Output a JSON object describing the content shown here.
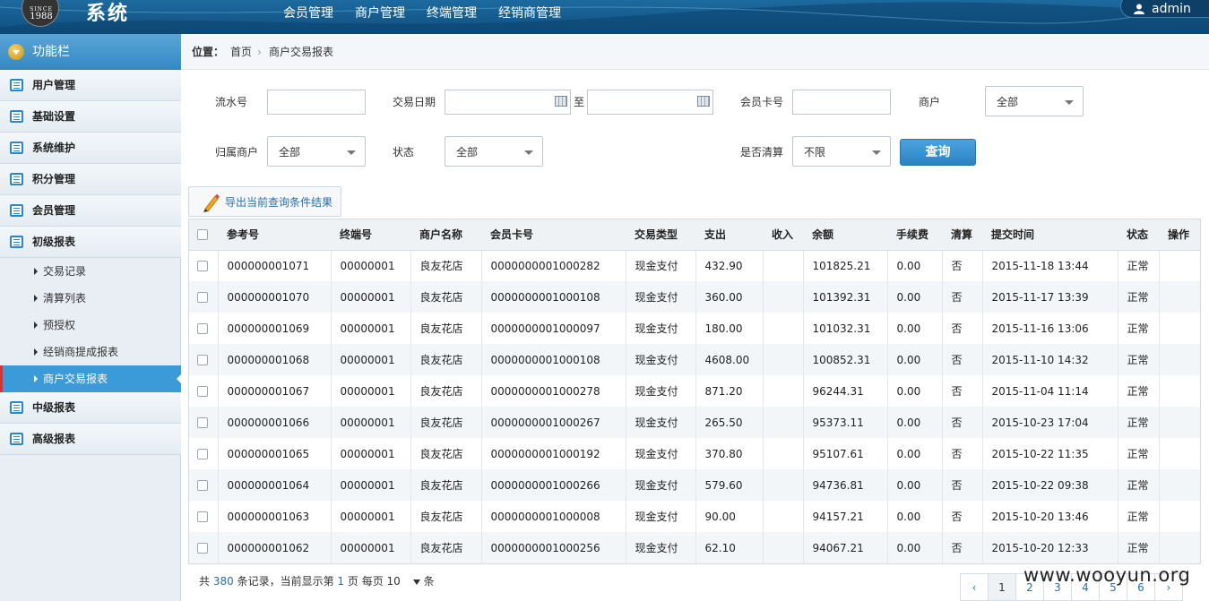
{
  "header": {
    "logo": {
      "since": "SINCE",
      "year": "1988"
    },
    "title": "系统",
    "nav": [
      "会员管理",
      "商户管理",
      "终端管理",
      "经销商管理"
    ],
    "user": "admin"
  },
  "sidebar": {
    "title": "功能栏",
    "items_top": [
      "用户管理",
      "基础设置",
      "系统维护",
      "积分管理",
      "会员管理",
      "初级报表"
    ],
    "sub_items": [
      "交易记录",
      "清算列表",
      "预授权",
      "经销商提成报表",
      "商户交易报表"
    ],
    "active_sub": "商户交易报表",
    "items_bottom": [
      "中级报表",
      "高级报表"
    ]
  },
  "breadcrumb": {
    "label": "位置：",
    "home": "首页",
    "sep": "›",
    "current": "商户交易报表"
  },
  "form": {
    "serial_label": "流水号",
    "serial_value": "",
    "date_label": "交易日期",
    "date_to": "至",
    "card_label": "会员卡号",
    "merchant_label": "商户",
    "merchant_value": "全部",
    "owner_label": "归属商户",
    "owner_value": "全部",
    "status_label": "状态",
    "status_value": "全部",
    "cleared_label": "是否清算",
    "cleared_value": "不限",
    "search_button": "查询",
    "export_button": "导出当前查询条件结果"
  },
  "table": {
    "columns": [
      "参考号",
      "终端号",
      "商户名称",
      "会员卡号",
      "交易类型",
      "支出",
      "收入",
      "余额",
      "手续费",
      "清算",
      "提交时间",
      "状态",
      "操作"
    ],
    "rows": [
      [
        "000000001071",
        "00000001",
        "良友花店",
        "0000000001000282",
        "现金支付",
        "432.90",
        "",
        "101825.21",
        "0.00",
        "否",
        "2015-11-18 13:44",
        "正常",
        ""
      ],
      [
        "000000001070",
        "00000001",
        "良友花店",
        "0000000001000108",
        "现金支付",
        "360.00",
        "",
        "101392.31",
        "0.00",
        "否",
        "2015-11-17 13:39",
        "正常",
        ""
      ],
      [
        "000000001069",
        "00000001",
        "良友花店",
        "0000000001000097",
        "现金支付",
        "180.00",
        "",
        "101032.31",
        "0.00",
        "否",
        "2015-11-16 13:06",
        "正常",
        ""
      ],
      [
        "000000001068",
        "00000001",
        "良友花店",
        "0000000001000108",
        "现金支付",
        "4608.00",
        "",
        "100852.31",
        "0.00",
        "否",
        "2015-11-10 14:32",
        "正常",
        ""
      ],
      [
        "000000001067",
        "00000001",
        "良友花店",
        "0000000001000278",
        "现金支付",
        "871.20",
        "",
        "96244.31",
        "0.00",
        "否",
        "2015-11-04 11:14",
        "正常",
        ""
      ],
      [
        "000000001066",
        "00000001",
        "良友花店",
        "0000000001000267",
        "现金支付",
        "265.50",
        "",
        "95373.11",
        "0.00",
        "否",
        "2015-10-23 17:04",
        "正常",
        ""
      ],
      [
        "000000001065",
        "00000001",
        "良友花店",
        "0000000001000192",
        "现金支付",
        "370.80",
        "",
        "95107.61",
        "0.00",
        "否",
        "2015-10-22 11:35",
        "正常",
        ""
      ],
      [
        "000000001064",
        "00000001",
        "良友花店",
        "0000000001000266",
        "现金支付",
        "579.60",
        "",
        "94736.81",
        "0.00",
        "否",
        "2015-10-22 09:38",
        "正常",
        ""
      ],
      [
        "000000001063",
        "00000001",
        "良友花店",
        "0000000001000008",
        "现金支付",
        "90.00",
        "",
        "94157.21",
        "0.00",
        "否",
        "2015-10-20 13:46",
        "正常",
        ""
      ],
      [
        "000000001062",
        "00000001",
        "良友花店",
        "0000000001000256",
        "现金支付",
        "62.10",
        "",
        "94067.21",
        "0.00",
        "否",
        "2015-10-20 12:33",
        "正常",
        ""
      ]
    ]
  },
  "footer": {
    "total_prefix": "共",
    "total": "380",
    "total_suffix": "条记录，当前显示第",
    "page": "1",
    "per_page_label": "页 每页",
    "per_page": "10",
    "unit": "条"
  },
  "pager": {
    "prev": "‹",
    "pages": [
      "1",
      "2",
      "3",
      "4",
      "5",
      "6"
    ],
    "next": "›"
  },
  "watermark": "www.wooyun.org",
  "colors": {
    "header": "#0f4f7e",
    "accent": "#3a9bd8",
    "active_marker": "#d9342b",
    "link": "#2a6fa8"
  }
}
